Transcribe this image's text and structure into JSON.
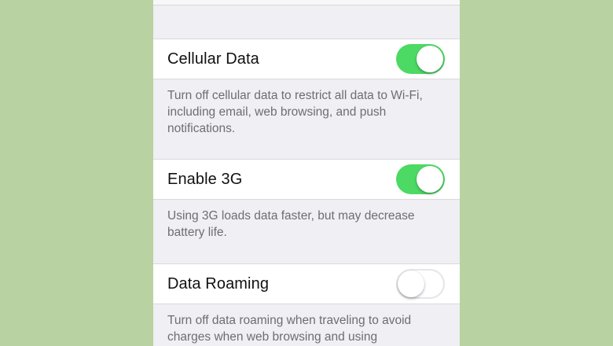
{
  "colors": {
    "background": "#b9d2a2",
    "settings_bg": "#efeff4",
    "toggle_on": "#4cd964",
    "toggle_off_border": "#e5e5ea"
  },
  "settings": {
    "cellular_data": {
      "label": "Cellular Data",
      "enabled": true,
      "description": "Turn off cellular data to restrict all data to Wi-Fi, including email, web browsing, and push notifications."
    },
    "enable_3g": {
      "label": "Enable 3G",
      "enabled": true,
      "description": "Using 3G loads data faster, but may decrease battery life."
    },
    "data_roaming": {
      "label": "Data Roaming",
      "enabled": false,
      "description": "Turn off data roaming when traveling to avoid charges when web browsing and using"
    }
  },
  "icons": {
    "toggle": "switch-icon"
  }
}
